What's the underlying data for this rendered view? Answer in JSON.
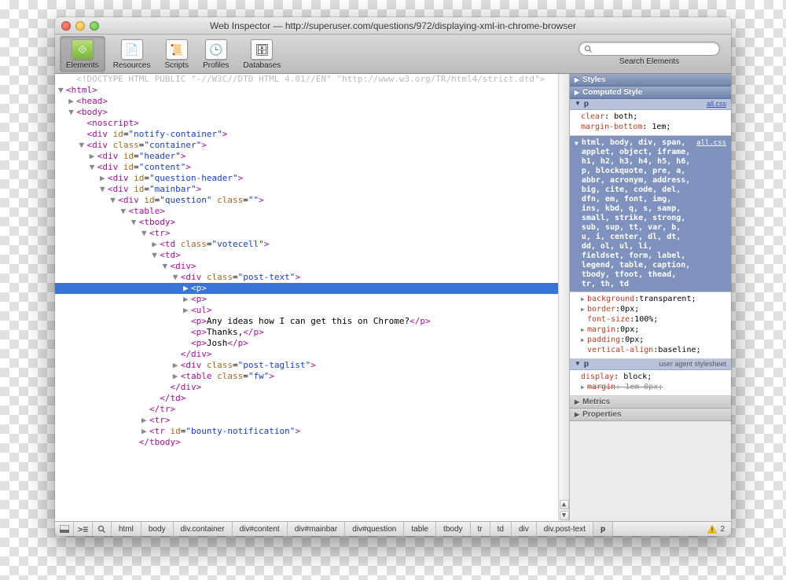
{
  "title": "Web Inspector — http://superuser.com/questions/972/displaying-xml-in-chrome-browser",
  "toolbar": {
    "elements": "Elements",
    "resources": "Resources",
    "scripts": "Scripts",
    "profiles": "Profiles",
    "databases": "Databases"
  },
  "search": {
    "placeholder": "",
    "label": "Search Elements"
  },
  "dom": {
    "doctype": "<!DOCTYPE HTML PUBLIC \"-//W3C//DTD HTML 4.01//EN\" \"http://www.w3.org/TR/html4/strict.dtd\">",
    "text1": "Any ideas how I can get this on Chrome?",
    "text2": "Thanks,",
    "text3": "Josh"
  },
  "styles": {
    "hdr_styles": "Styles",
    "hdr_computed": "Computed Style",
    "hdr_metrics": "Metrics",
    "hdr_properties": "Properties",
    "rule1_sel": "p",
    "rule1_src": "all.css",
    "rule1_p1": "clear",
    "rule1_v1": "both;",
    "rule1_p2": "margin-bottom",
    "rule1_v2": "1em;",
    "rule2_sel": "html, body, div, span, applet, object, iframe, h1, h2, h3, h4, h5, h6, p, blockquote, pre, a, abbr, acronym, address, big, cite, code, del, dfn, em, font, img, ins, kbd, q, s, samp, small, strike, strong, sub, sup, tt, var, b, u, i, center, dl, dt, dd, ol, ul, li, fieldset, form, label, legend, table, caption, tbody, tfoot, thead, tr, th, td",
    "rule2_src": "all.css",
    "rule2_p1": "background",
    "rule2_v1": "transparent;",
    "rule2_p2": "border",
    "rule2_v2": "0px;",
    "rule2_p3": "font-size",
    "rule2_v3": "100%;",
    "rule2_p4": "margin",
    "rule2_v4": "0px;",
    "rule2_p5": "padding",
    "rule2_v5": "0px;",
    "rule2_p6": "vertical-align",
    "rule2_v6": "baseline;",
    "rule3_sel": "p",
    "rule3_src": "user agent stylesheet",
    "rule3_p1": "display",
    "rule3_v1": "block;",
    "rule3_p2": "margin",
    "rule3_v2": "1em 0px;"
  },
  "breadcrumbs": [
    "html",
    "body",
    "div.container",
    "div#content",
    "div#mainbar",
    "div#question",
    "table",
    "tbody",
    "tr",
    "td",
    "div",
    "div.post-text",
    "p"
  ],
  "errors": "2"
}
